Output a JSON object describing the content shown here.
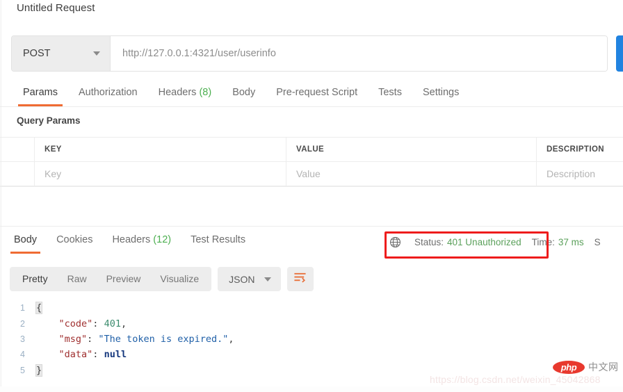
{
  "request": {
    "title": "Untitled Request",
    "method": "POST",
    "method_caret_icon": "chevron-down-icon",
    "url": "http://127.0.0.1:4321/user/userinfo",
    "send_label": "",
    "tabs": [
      {
        "label": "Params",
        "count": "",
        "active": true
      },
      {
        "label": "Authorization",
        "count": "",
        "active": false
      },
      {
        "label": "Headers",
        "count": "(8)",
        "active": false
      },
      {
        "label": "Body",
        "count": "",
        "active": false
      },
      {
        "label": "Pre-request Script",
        "count": "",
        "active": false
      },
      {
        "label": "Tests",
        "count": "",
        "active": false
      },
      {
        "label": "Settings",
        "count": "",
        "active": false
      }
    ]
  },
  "query_params": {
    "section_label": "Query Params",
    "columns": [
      "",
      "KEY",
      "VALUE",
      "DESCRIPTION"
    ],
    "rows": [
      {
        "key": "Key",
        "value": "Value",
        "description": "Description"
      }
    ]
  },
  "response": {
    "tabs": [
      {
        "label": "Body",
        "count": "",
        "active": true
      },
      {
        "label": "Cookies",
        "count": "",
        "active": false
      },
      {
        "label": "Headers",
        "count": "(12)",
        "active": false
      },
      {
        "label": "Test Results",
        "count": "",
        "active": false
      }
    ],
    "meta": {
      "globe_icon": "globe-icon",
      "status_label": "Status:",
      "status_value": "401 Unauthorized",
      "time_label": "Time:",
      "time_value": "37 ms",
      "size_label_truncated": "S"
    },
    "toolbar": {
      "view_modes": [
        {
          "label": "Pretty",
          "active": true
        },
        {
          "label": "Raw",
          "active": false
        },
        {
          "label": "Preview",
          "active": false
        },
        {
          "label": "Visualize",
          "active": false
        }
      ],
      "format": "JSON",
      "format_caret_icon": "chevron-down-icon",
      "wrap_icon": "word-wrap-icon"
    },
    "body_lines": [
      {
        "num": "1",
        "tokens": [
          {
            "t": "brace",
            "v": "{"
          }
        ]
      },
      {
        "num": "2",
        "tokens": [
          {
            "t": "plain",
            "v": "    "
          },
          {
            "t": "key",
            "v": "\"code\""
          },
          {
            "t": "punct",
            "v": ": "
          },
          {
            "t": "num",
            "v": "401"
          },
          {
            "t": "punct",
            "v": ","
          }
        ]
      },
      {
        "num": "3",
        "tokens": [
          {
            "t": "plain",
            "v": "    "
          },
          {
            "t": "key",
            "v": "\"msg\""
          },
          {
            "t": "punct",
            "v": ": "
          },
          {
            "t": "str",
            "v": "\"The token is expired.\""
          },
          {
            "t": "punct",
            "v": ","
          }
        ]
      },
      {
        "num": "4",
        "tokens": [
          {
            "t": "plain",
            "v": "    "
          },
          {
            "t": "key",
            "v": "\"data\""
          },
          {
            "t": "punct",
            "v": ": "
          },
          {
            "t": "null",
            "v": "null"
          }
        ]
      },
      {
        "num": "5",
        "tokens": [
          {
            "t": "brace",
            "v": "}"
          }
        ]
      }
    ]
  },
  "watermark": {
    "url": "https://blog.csdn.net/weixin_45042868",
    "logo_text": "php",
    "logo_suffix": "中文网"
  },
  "colors": {
    "accent_orange": "#ef6b33",
    "send_blue": "#2183e0",
    "status_green": "#5ba05b",
    "annotation_red": "#ee1c1c",
    "count_green": "#4caf50"
  }
}
